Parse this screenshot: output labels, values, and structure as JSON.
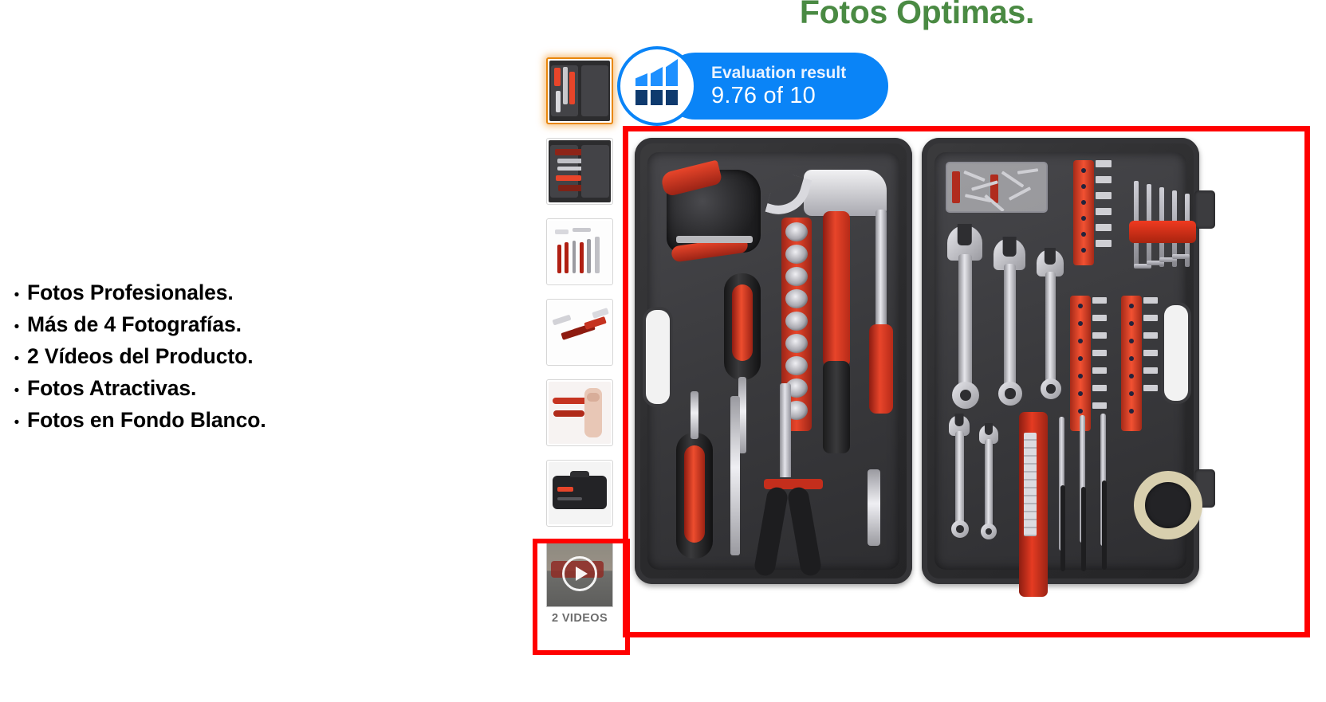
{
  "title": "Fotos Óptimas.",
  "title_color": "#4A8A43",
  "bullets": [
    {
      "marker": "•",
      "text": "Fotos Profesionales."
    },
    {
      "marker": "•",
      "text": "Más de 4 Fotografías."
    },
    {
      "marker": "•",
      "text": "2 Vídeos del Producto."
    },
    {
      "marker": "•",
      "text": "Fotos Atractivas."
    },
    {
      "marker": "•",
      "text": "Fotos en Fondo Blanco."
    }
  ],
  "evaluation_badge": {
    "label": "Evaluation result",
    "score": "9.76 of 10",
    "score_value": 9.76,
    "score_max": 10,
    "background_color": "#0A84F7",
    "icon": "bar-chart-icon"
  },
  "gallery": {
    "thumbnails": [
      {
        "id": "thumb-1",
        "alt": "Tool case open with tools",
        "selected": true
      },
      {
        "id": "thumb-2",
        "alt": "Tool case angled view",
        "selected": false
      },
      {
        "id": "thumb-3",
        "alt": "Tools laid out on white background",
        "selected": false
      },
      {
        "id": "thumb-4",
        "alt": "Screwdrivers and tools on white",
        "selected": false
      },
      {
        "id": "thumb-5",
        "alt": "Hand holding tool",
        "selected": false
      },
      {
        "id": "thumb-6",
        "alt": "Closed black tool case",
        "selected": false
      }
    ],
    "video_thumbnail": {
      "id": "video-thumb",
      "alt": "Product video preview",
      "label": "2 VIDEOS",
      "play_icon": "play-icon"
    },
    "selected_border_color": "#E8860C",
    "highlight_color": "#FF0000",
    "main_image_alt": "Open tool case with hammer, tape measure, wrenches, screwdrivers and bits"
  },
  "highlights": [
    {
      "name": "main-image-highlight",
      "color": "#FF0000"
    },
    {
      "name": "video-thumbnail-highlight",
      "color": "#FF0000"
    }
  ]
}
